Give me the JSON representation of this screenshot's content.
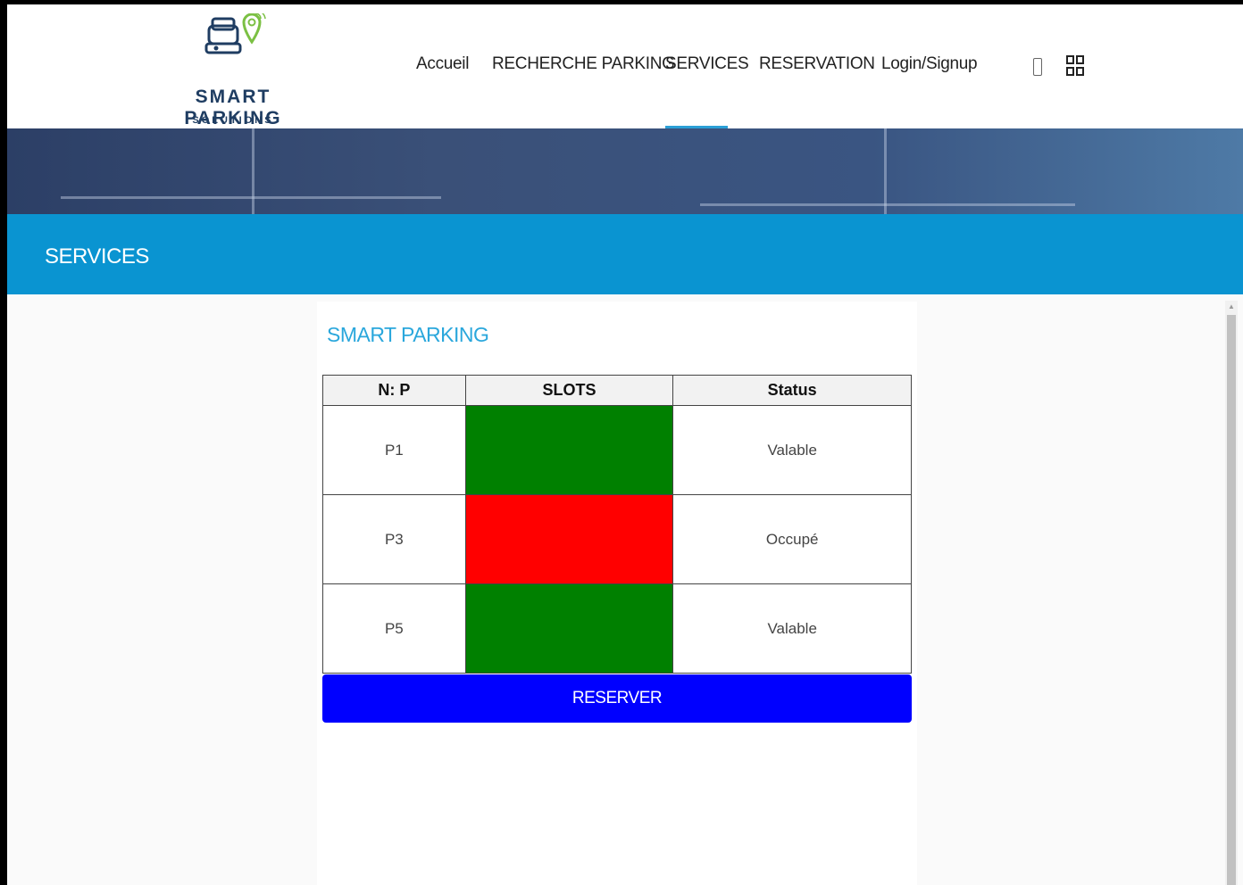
{
  "brand": {
    "name": "SMART PARKING",
    "tagline": "SOLUTIONS",
    "logo_icon": "car-location-pin-icon"
  },
  "nav": {
    "items": [
      {
        "label": "Accueil",
        "active": false
      },
      {
        "label": "RECHERCHE PARKING",
        "active": false
      },
      {
        "label": "SERVICES",
        "active": true
      },
      {
        "label": "RESERVATION",
        "active": false
      },
      {
        "label": "Login/Signup",
        "active": false
      }
    ],
    "icons": [
      "phone-icon",
      "grid-menu-icon"
    ]
  },
  "section": {
    "title": "SERVICES"
  },
  "card": {
    "title": "SMART PARKING",
    "table": {
      "headers": [
        "N: P",
        "SLOTS",
        "Status"
      ],
      "rows": [
        {
          "place": "P1",
          "slot_color": "#008000",
          "status": "Valable"
        },
        {
          "place": "P3",
          "slot_color": "#ff0000",
          "status": "Occupé"
        },
        {
          "place": "P5",
          "slot_color": "#008000",
          "status": "Valable"
        }
      ]
    },
    "button_label": "RESERVER"
  },
  "colors": {
    "accent": "#0a94d1",
    "title": "#2aa7dc",
    "button": "#0000ff",
    "available": "#008000",
    "occupied": "#ff0000"
  }
}
